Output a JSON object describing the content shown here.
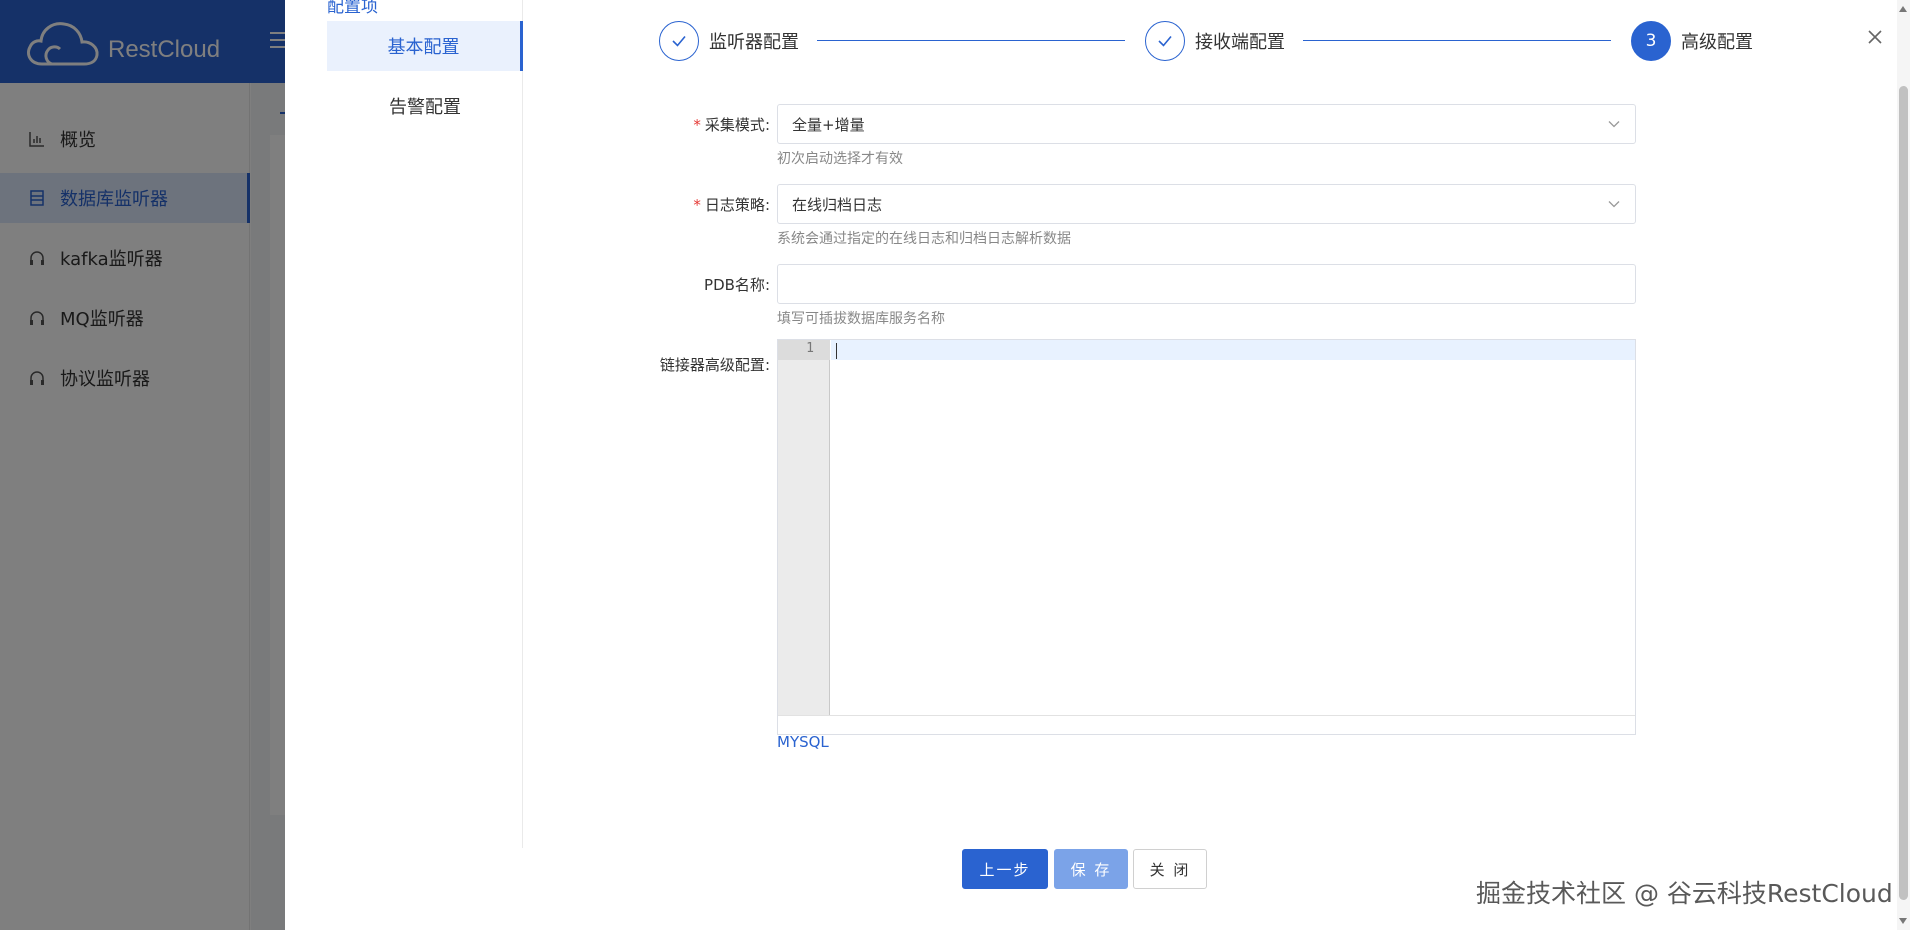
{
  "app": {
    "brand": "RestCloud"
  },
  "sidebar": {
    "items": [
      {
        "label": "概览",
        "icon": "bar-chart-icon"
      },
      {
        "label": "数据库监听器",
        "icon": "list-icon"
      },
      {
        "label": "kafka监听器",
        "icon": "headset-icon"
      },
      {
        "label": "MQ监听器",
        "icon": "headset-icon"
      },
      {
        "label": "协议监听器",
        "icon": "headset-icon"
      }
    ],
    "active_index": 1
  },
  "drawer": {
    "menu_title": "配置项",
    "menu_items": [
      {
        "label": "基本配置"
      },
      {
        "label": "告警配置"
      }
    ],
    "steps": [
      {
        "index": "1",
        "label": "监听器配置",
        "status": "done"
      },
      {
        "index": "2",
        "label": "接收端配置",
        "status": "done"
      },
      {
        "index": "3",
        "label": "高级配置",
        "status": "current"
      }
    ],
    "close_icon": "close-icon"
  },
  "form": {
    "collect_mode": {
      "label": "采集模式",
      "value": "全量+增量",
      "hint": "初次启动选择才有效"
    },
    "log_strategy": {
      "label": "日志策略",
      "value": "在线归档日志",
      "hint": "系统会通过指定的在线日志和归档日志解析数据"
    },
    "pdb_name": {
      "label": "PDB名称",
      "value": "",
      "hint": "填写可插拔数据库服务名称"
    },
    "advanced_config": {
      "label": "链接器高级配置",
      "line_number": "1",
      "language": "MYSQL"
    }
  },
  "buttons": {
    "prev": "上一步",
    "save": "保 存",
    "close": "关 闭"
  },
  "watermark": "掘金技术社区 @ 谷云科技RestCloud",
  "colors": {
    "primary": "#2a63d0",
    "overlay": "rgba(0,0,0,0.5)",
    "required": "#e53935"
  }
}
